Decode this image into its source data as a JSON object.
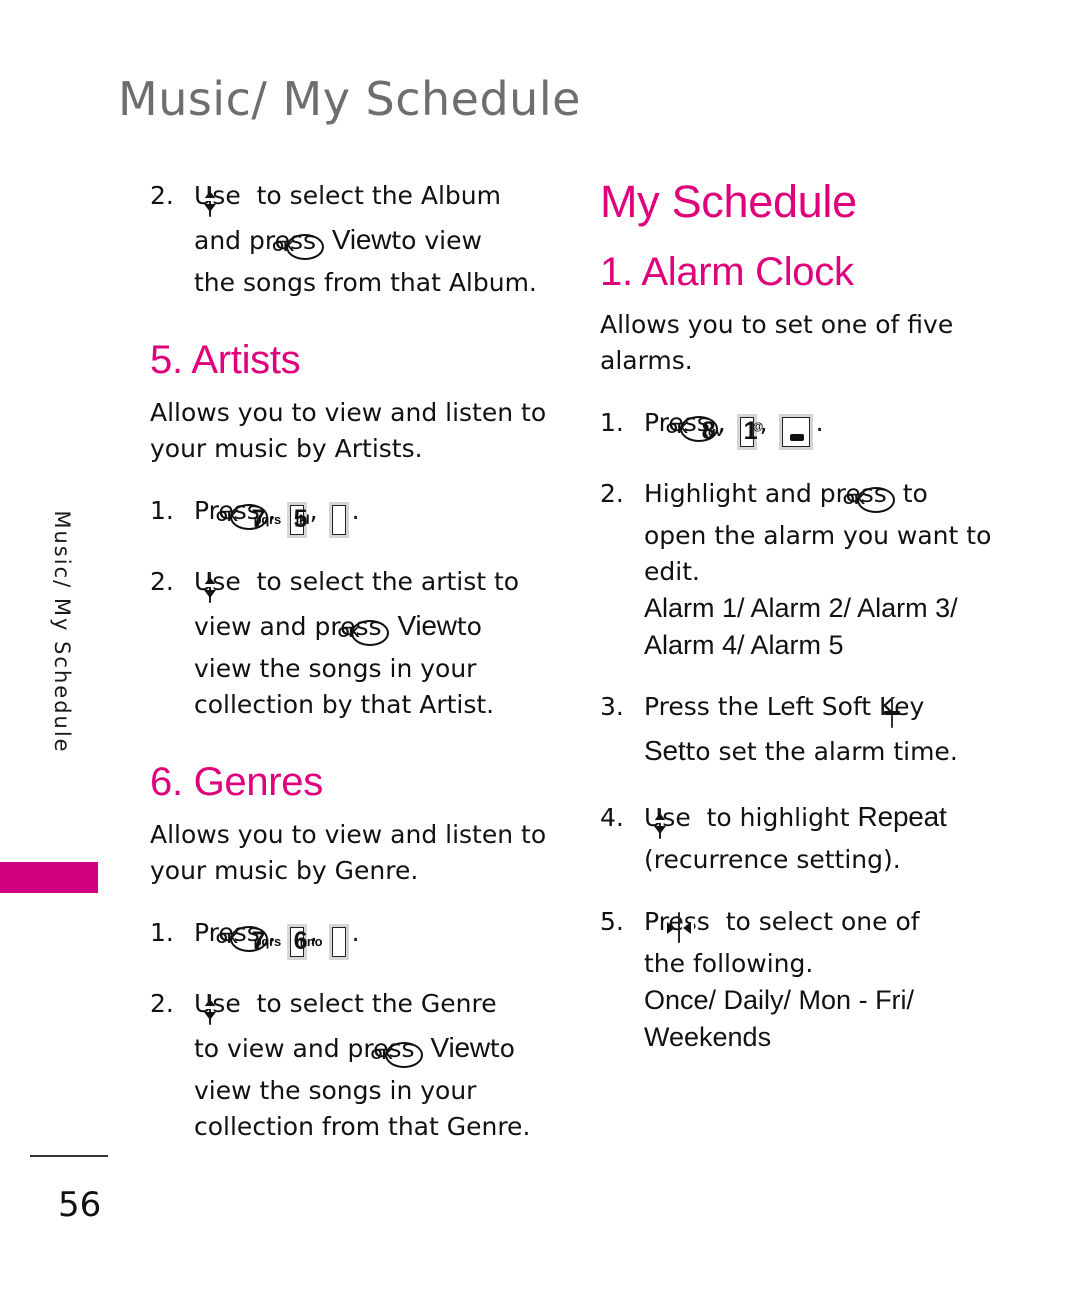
{
  "header": {
    "title": "Music/ My Schedule"
  },
  "side_tab": {
    "label": "Music/ My Schedule"
  },
  "footer": {
    "page_number": "56"
  },
  "colors": {
    "accent_magenta": "#e0007c",
    "tab_magenta": "#d1007f",
    "header_gray": "#6e6e6e",
    "key_gray": "#d6d6d6"
  },
  "left_column": {
    "intro_step": {
      "num": "2.",
      "lead": "Use",
      "mid": "to select the Album",
      "line2_a": "and press",
      "line2_kw": "View",
      "line2_b": "to view",
      "line3": "the songs from that Album."
    },
    "artists": {
      "heading": "5. Artists",
      "body_line1": "Allows you to view and listen to",
      "body_line2": "your music by Artists.",
      "step1": {
        "num": "1.",
        "text": "Press",
        "sep1": ",",
        "sep2": ",",
        "end": "."
      },
      "step1_keys": [
        {
          "type": "ok",
          "label": "OK"
        },
        {
          "type": "num",
          "digit": "7",
          "letters": "pqrs"
        },
        {
          "type": "num",
          "digit": "5",
          "letters": "jkl"
        }
      ],
      "step2": {
        "num": "2.",
        "lead": "Use",
        "mid": "to select the artist to",
        "line2_a": "view and press",
        "line2_kw": "View",
        "line2_b": "to",
        "line3": "view the songs in your",
        "line4": "collection by that Artist."
      }
    },
    "genres": {
      "heading": "6. Genres",
      "body_line1": "Allows you to view and listen to",
      "body_line2": "your music by Genre.",
      "step1": {
        "num": "1.",
        "text": "Press",
        "sep1": ",",
        "sep2": ",",
        "end": "."
      },
      "step1_keys": [
        {
          "type": "ok",
          "label": "OK"
        },
        {
          "type": "num",
          "digit": "7",
          "letters": "pqrs"
        },
        {
          "type": "num",
          "digit": "6",
          "letters": "mno"
        }
      ],
      "step2": {
        "num": "2.",
        "lead": "Use",
        "mid": "to select the Genre",
        "line2_a": "to view and press",
        "line2_kw": "View",
        "line2_b": "to",
        "line3": "view the songs in your",
        "line4": "collection from that Genre."
      }
    }
  },
  "right_column": {
    "title": "My Schedule",
    "alarm_clock": {
      "heading": "1. Alarm Clock",
      "body_line1": "Allows you to set one of five",
      "body_line2": "alarms.",
      "step1": {
        "num": "1.",
        "text": "Press",
        "sep1": ",",
        "sep2": ",",
        "end": "."
      },
      "step1_keys": [
        {
          "type": "ok",
          "label": "OK"
        },
        {
          "type": "num",
          "digit": "8",
          "letters": "tuv"
        },
        {
          "type": "num",
          "digit": "1",
          "letters": "voicemail"
        }
      ],
      "step2": {
        "num": "2.",
        "lead": "Highlight and press",
        "tail": "to",
        "line2": "open the alarm you want to",
        "line3": "edit.",
        "options_line1": "Alarm 1/ Alarm 2/ Alarm 3/",
        "options_line2": "Alarm 4/ Alarm 5"
      },
      "step3": {
        "num": "3.",
        "lead": "Press the Left Soft Key",
        "line2_kw": "Set",
        "line2_b": "to set the alarm time."
      },
      "step4": {
        "num": "4.",
        "lead": "Use",
        "mid": "to highlight",
        "kw": "Repeat",
        "line2": "(recurrence setting)."
      },
      "step5": {
        "num": "5.",
        "lead": "Press",
        "mid": "to select one of",
        "line2": "the following.",
        "options_line1": "Once/ Daily/ Mon - Fri/",
        "options_line2": "Weekends"
      }
    }
  }
}
